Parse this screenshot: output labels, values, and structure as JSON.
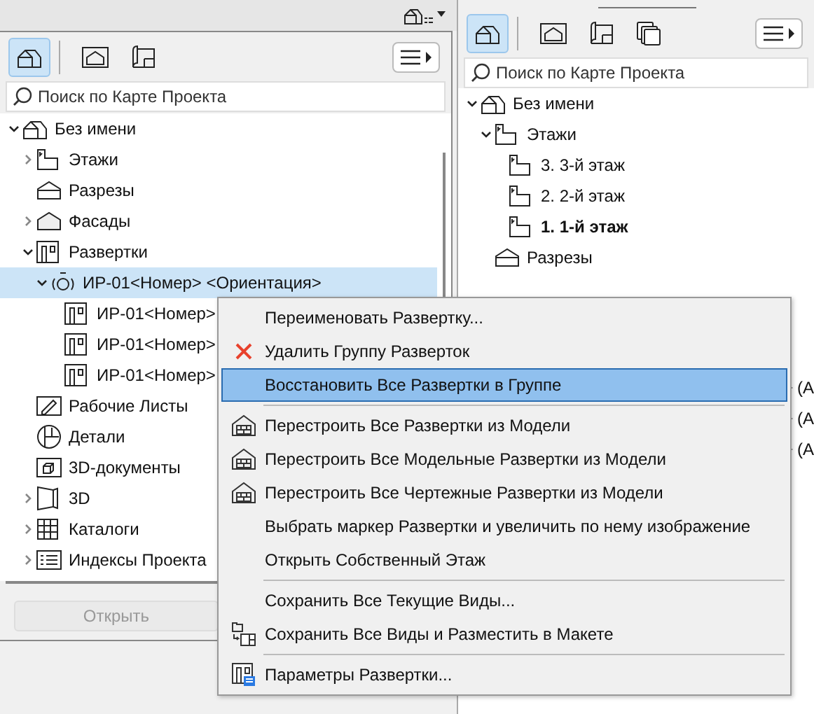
{
  "left_panel": {
    "toolbar": {
      "buttons": [
        {
          "kind": "house",
          "selected": true
        },
        {
          "kind": "sheet",
          "selected": false
        },
        {
          "kind": "book",
          "selected": false
        }
      ]
    },
    "search": {
      "placeholder": "Поиск по Карте Проекта"
    },
    "tree": [
      {
        "label": "Без имени",
        "kind": "house",
        "expanded": true,
        "selected": false,
        "children": [
          {
            "label": "Этажи",
            "kind": "floor",
            "expanded": false,
            "selected": false
          },
          {
            "label": "Разрезы",
            "kind": "section",
            "selected": false
          },
          {
            "label": "Фасады",
            "kind": "elevation",
            "expanded": false,
            "selected": false
          },
          {
            "label": "Развертки",
            "kind": "interior",
            "expanded": true,
            "selected": false,
            "children": [
              {
                "label": "ИР-01<Номер> <Ориентация>",
                "kind": "group",
                "expanded": true,
                "selected": true,
                "children": [
                  {
                    "label": "ИР-01<Номер>",
                    "kind": "interior",
                    "selected": false
                  },
                  {
                    "label": "ИР-01<Номер>",
                    "kind": "interior",
                    "selected": false
                  },
                  {
                    "label": "ИР-01<Номер>",
                    "kind": "interior",
                    "selected": false
                  }
                ]
              }
            ]
          },
          {
            "label": "Рабочие Листы",
            "kind": "worksheet",
            "selected": false
          },
          {
            "label": "Детали",
            "kind": "detail",
            "selected": false
          },
          {
            "label": "3D-документы",
            "kind": "doc3d",
            "selected": false
          },
          {
            "label": "3D",
            "kind": "model3d",
            "expanded": false,
            "selected": false
          },
          {
            "label": "Каталоги",
            "kind": "schedule",
            "expanded": false,
            "selected": false
          },
          {
            "label": "Индексы Проекта",
            "kind": "index",
            "expanded": false,
            "selected": false
          }
        ]
      }
    ],
    "open_button": {
      "label": "Открыть",
      "disabled": true
    }
  },
  "right_panel": {
    "toolbar": {
      "buttons": [
        {
          "kind": "house",
          "selected": true
        },
        {
          "kind": "sheet",
          "selected": false
        },
        {
          "kind": "book",
          "selected": false
        },
        {
          "kind": "stack",
          "selected": false
        }
      ]
    },
    "search": {
      "placeholder": "Поиск по Карте Проекта"
    },
    "tree": [
      {
        "label": "Без имени",
        "kind": "house",
        "expanded": true,
        "selected": false,
        "children": [
          {
            "label": "Этажи",
            "kind": "floor",
            "expanded": true,
            "selected": false,
            "children": [
              {
                "label": "3. 3-й этаж",
                "kind": "floor",
                "current": false,
                "selected": false
              },
              {
                "label": "2. 2-й этаж",
                "kind": "floor",
                "current": false,
                "selected": false
              },
              {
                "label": "1. 1-й этаж",
                "kind": "floor",
                "current": true,
                "selected": false
              }
            ]
          },
          {
            "label": "Разрезы",
            "kind": "section",
            "selected": false
          }
        ]
      }
    ],
    "cut_labels": [
      "(A",
      "(A",
      "(A"
    ]
  },
  "context_menu": [
    {
      "kind": "plain",
      "label": "Переименовать Развертку...",
      "selected": false
    },
    {
      "kind": "delete",
      "label": "Удалить Группу Разверток",
      "selected": false
    },
    {
      "kind": "plain",
      "label": "Восстановить Все Развертки в Группе",
      "selected": true
    },
    {
      "kind": "separator"
    },
    {
      "kind": "rebuild",
      "label": "Перестроить Все Развертки из Модели",
      "selected": false
    },
    {
      "kind": "rebuild",
      "label": "Перестроить Все Модельные Развертки из Модели",
      "selected": false
    },
    {
      "kind": "rebuild",
      "label": "Перестроить Все Чертежные Развертки из Модели",
      "selected": false
    },
    {
      "kind": "plain",
      "label": "Выбрать маркер Развертки и увеличить по нему изображение",
      "selected": false
    },
    {
      "kind": "plain",
      "label": "Открыть Собственный Этаж",
      "selected": false
    },
    {
      "kind": "separator"
    },
    {
      "kind": "plain",
      "label": "Сохранить Все Текущие Виды...",
      "selected": false
    },
    {
      "kind": "place",
      "label": "Сохранить Все Виды и Разместить в Макете",
      "selected": false
    },
    {
      "kind": "separator"
    },
    {
      "kind": "settings",
      "label": "Параметры Развертки...",
      "selected": false
    }
  ]
}
